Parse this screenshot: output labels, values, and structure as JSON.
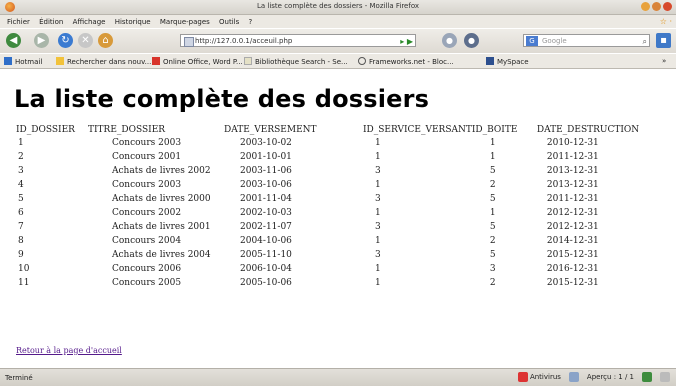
{
  "window": {
    "title": "La liste complète des dossiers - Mozilla Firefox"
  },
  "menu": [
    "Fichier",
    "Édition",
    "Affichage",
    "Historique",
    "Marque-pages",
    "Outils",
    "?"
  ],
  "nav": {
    "url": "http://127.0.0.1/acceuil.php",
    "search_placeholder": "Google"
  },
  "bookmarks": [
    "Hotmail",
    "Rechercher dans nouv...",
    "Online Office, Word P...",
    "Bibliothèque Search - Se...",
    "Frameworks.net - Bloc...",
    "MySpace"
  ],
  "page": {
    "heading": "La liste complète des dossiers",
    "columns": [
      "ID_DOSSIER",
      "TITRE_DOSSIER",
      "DATE_VERSEMENT",
      "ID_SERVICE_VERSANT",
      "ID_BOITE",
      "DATE_DESTRUCTION"
    ],
    "rows": [
      [
        "1",
        "Concours 2003",
        "2003-10-02",
        "1",
        "1",
        "2010-12-31"
      ],
      [
        "2",
        "Concours 2001",
        "2001-10-01",
        "1",
        "1",
        "2011-12-31"
      ],
      [
        "3",
        "Achats de livres 2002",
        "2003-11-06",
        "3",
        "5",
        "2013-12-31"
      ],
      [
        "4",
        "Concours 2003",
        "2003-10-06",
        "1",
        "2",
        "2013-12-31"
      ],
      [
        "5",
        "Achats de livres 2000",
        "2001-11-04",
        "3",
        "5",
        "2011-12-31"
      ],
      [
        "6",
        "Concours 2002",
        "2002-10-03",
        "1",
        "1",
        "2012-12-31"
      ],
      [
        "7",
        "Achats de livres 2001",
        "2002-11-07",
        "3",
        "5",
        "2012-12-31"
      ],
      [
        "8",
        "Concours 2004",
        "2004-10-06",
        "1",
        "2",
        "2014-12-31"
      ],
      [
        "9",
        "Achats de livres 2004",
        "2005-11-10",
        "3",
        "5",
        "2015-12-31"
      ],
      [
        "10",
        "Concours 2006",
        "2006-10-04",
        "1",
        "3",
        "2016-12-31"
      ],
      [
        "11",
        "Concours 2005",
        "2005-10-06",
        "1",
        "2",
        "2015-12-31"
      ]
    ],
    "back_link": "Retour à la page d'accueil"
  },
  "status": {
    "text": "Terminé",
    "right_items": [
      "Antivirus",
      "Aperçu : 1 / 1"
    ]
  }
}
